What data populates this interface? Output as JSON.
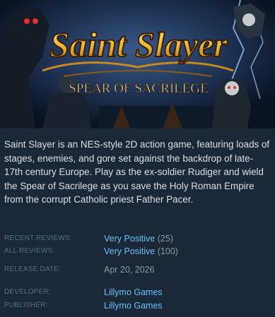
{
  "capsule": {
    "title_line1": "Saint Slayer",
    "title_line2": "SPEAR OF SACRILEGE"
  },
  "description": "Saint Slayer is an NES-style 2D action game, featuring loads of stages, enemies, and gore set against the backdrop of late-17th century Europe. Play as the ex-soldier Rudiger and wield the Spear of Sacrilege as you save the Holy Roman Empire from the corrupt Catholic priest Father Pacer.",
  "reviews": {
    "recent_label": "RECENT REVIEWS:",
    "recent_summary": "Very Positive",
    "recent_count": "(25)",
    "all_label": "ALL REVIEWS:",
    "all_summary": "Very Positive",
    "all_count": "(100)"
  },
  "release": {
    "label": "RELEASE DATE:",
    "date": "Apr 20, 2026"
  },
  "developer": {
    "label": "DEVELOPER:",
    "name": "Lillymo Games"
  },
  "publisher": {
    "label": "PUBLISHER:",
    "name": "Lillymo Games"
  },
  "colors": {
    "background": "#1b2838",
    "link": "#66c0f4",
    "label": "#56707f",
    "text": "#dcdfe3",
    "title_gold": "#e8b838"
  }
}
